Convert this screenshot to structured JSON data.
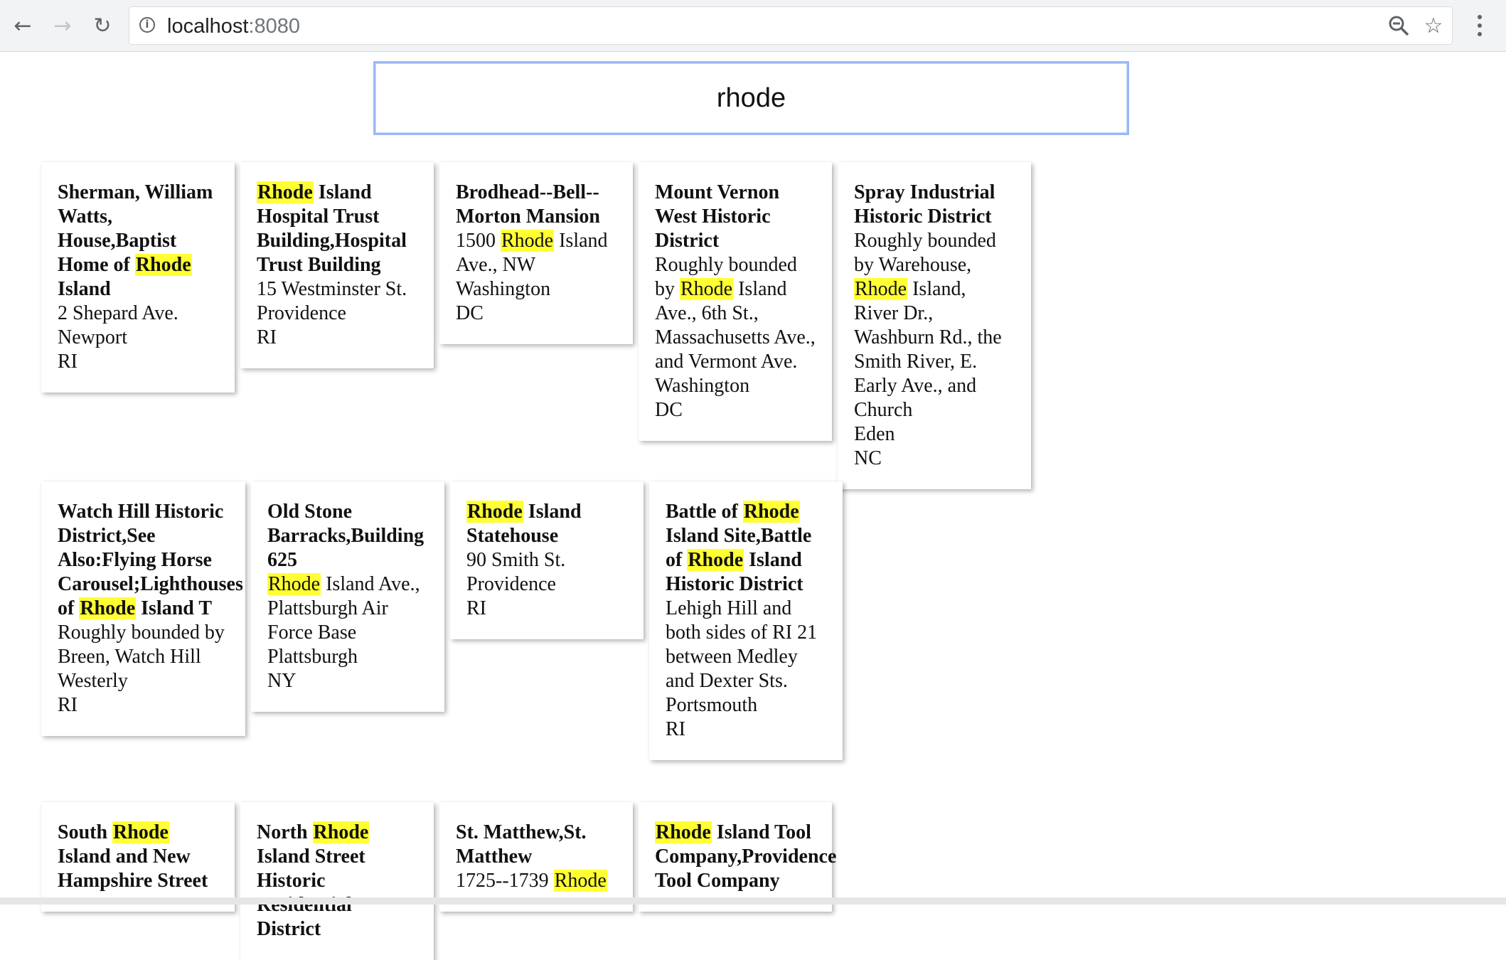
{
  "browser": {
    "url_host": "localhost",
    "url_port": ":8080",
    "icons": {
      "back": "arrow-left-icon",
      "forward": "arrow-right-icon",
      "reload": "reload-icon",
      "info": "info-icon",
      "zoom": "zoom-out-icon",
      "bookmark": "star-icon",
      "menu": "kebab-menu-icon"
    }
  },
  "search": {
    "value": "rhode",
    "highlight_color": "#ffff33"
  },
  "rows": [
    [
      {
        "title": [
          "Sherman, William Watts, House,Baptist Home of ",
          "Rhode",
          " Island"
        ],
        "address": "2 Shepard Ave.",
        "city": "Newport",
        "state": "RI"
      },
      {
        "title": [
          "",
          "Rhode",
          " Island Hospital Trust Building,Hospital Trust Building"
        ],
        "address": "15 Westminster St.",
        "city": "Providence",
        "state": "RI"
      },
      {
        "title": [
          "Brodhead--Bell--Morton Mansion"
        ],
        "address": [
          "1500 ",
          "Rhode",
          " Island Ave., NW"
        ],
        "city": "Washington",
        "state": "DC"
      },
      {
        "title": [
          "Mount Vernon West Historic District"
        ],
        "address": [
          "Roughly bounded by ",
          "Rhode",
          " Island Ave., 6th St., Massachusetts Ave., and Vermont Ave."
        ],
        "city": "Washington",
        "state": "DC"
      },
      {
        "title": [
          "Spray Industrial Historic District"
        ],
        "address": [
          "Roughly bounded by Warehouse, ",
          "Rhode",
          " Island, River Dr., Washburn Rd., the Smith River, E. Early Ave., and Church"
        ],
        "city": "Eden",
        "state": "NC"
      }
    ],
    [
      {
        "title": [
          "Watch Hill Historic District,See Also:Flying Horse Carousel;Lighthouses of ",
          "Rhode",
          " Island T"
        ],
        "address": "Roughly bounded by Breen, Watch Hill",
        "city": "Westerly",
        "state": "RI"
      },
      {
        "title": [
          "Old Stone Barracks,Building 625"
        ],
        "address": [
          "",
          "Rhode",
          " Island Ave., Plattsburgh Air Force Base"
        ],
        "city": "Plattsburgh",
        "state": "NY"
      },
      {
        "title": [
          "",
          "Rhode",
          " Island Statehouse"
        ],
        "address": "90 Smith St.",
        "city": "Providence",
        "state": "RI"
      },
      {
        "title": [
          "Battle of ",
          "Rhode",
          " Island Site,Battle of ",
          "Rhode",
          " Island Historic District"
        ],
        "address": "Lehigh Hill and both sides of RI 21 between Medley and Dexter Sts.",
        "city": "Portsmouth",
        "state": "RI"
      }
    ],
    [
      {
        "title": [
          "South ",
          "Rhode",
          " Island and New Hampshire Street"
        ]
      },
      {
        "title": [
          "North ",
          "Rhode",
          " Island Street Historic Residential District"
        ]
      },
      {
        "title": [
          "St. Matthew,St. Matthew"
        ],
        "address": [
          "1725--1739 ",
          "Rhode"
        ]
      },
      {
        "title": [
          "",
          "Rhode",
          " Island Tool Company,Providence Tool Company"
        ]
      }
    ]
  ]
}
